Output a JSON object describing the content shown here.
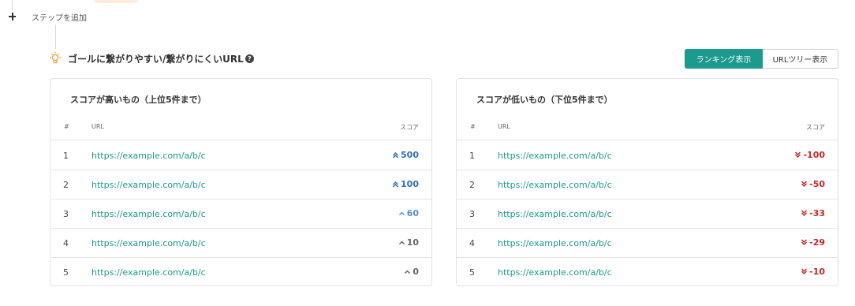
{
  "add_step": {
    "label": "ステップを追加"
  },
  "section": {
    "title": "ゴールに繋がりやすい/繋がりにくいURL"
  },
  "view_toggle": {
    "ranking_label": "ランキング表示",
    "tree_label": "URLツリー表示"
  },
  "high_card": {
    "title": "スコアが高いもの（上位5件まで）",
    "columns": {
      "num": "#",
      "url": "URL",
      "score": "スコア"
    },
    "rows": [
      {
        "num": "1",
        "url": "https://example.com/a/b/c",
        "score": "500",
        "icon": "double-chevron-up-icon",
        "color": "#2f6fb8"
      },
      {
        "num": "2",
        "url": "https://example.com/a/b/c",
        "score": "100",
        "icon": "double-chevron-up-icon",
        "color": "#2f6fb8"
      },
      {
        "num": "3",
        "url": "https://example.com/a/b/c",
        "score": "60",
        "icon": "chevron-up-icon",
        "color": "#5a8fd0"
      },
      {
        "num": "4",
        "url": "https://example.com/a/b/c",
        "score": "10",
        "icon": "chevron-up-icon",
        "color": "#666666"
      },
      {
        "num": "5",
        "url": "https://example.com/a/b/c",
        "score": "0",
        "icon": "chevron-up-icon",
        "color": "#666666"
      }
    ]
  },
  "low_card": {
    "title": "スコアが低いもの（下位5件まで）",
    "columns": {
      "num": "#",
      "url": "URL",
      "score": "スコア"
    },
    "rows": [
      {
        "num": "1",
        "url": "https://example.com/a/b/c",
        "score": "-100",
        "icon": "double-chevron-down-icon",
        "color": "#c62828"
      },
      {
        "num": "2",
        "url": "https://example.com/a/b/c",
        "score": "-50",
        "icon": "double-chevron-down-icon",
        "color": "#c62828"
      },
      {
        "num": "3",
        "url": "https://example.com/a/b/c",
        "score": "-33",
        "icon": "double-chevron-down-icon",
        "color": "#c62828"
      },
      {
        "num": "4",
        "url": "https://example.com/a/b/c",
        "score": "-29",
        "icon": "double-chevron-down-icon",
        "color": "#c62828"
      },
      {
        "num": "5",
        "url": "https://example.com/a/b/c",
        "score": "-10",
        "icon": "double-chevron-down-icon",
        "color": "#c62828"
      }
    ]
  },
  "colors": {
    "accent": "#1c9a8d",
    "positive": "#2f6fb8",
    "negative": "#c62828"
  }
}
